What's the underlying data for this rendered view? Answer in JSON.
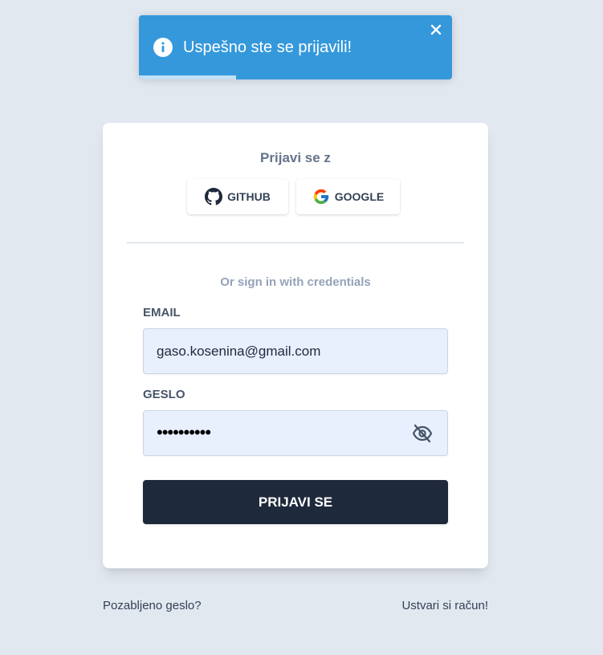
{
  "toast": {
    "message": "Uspešno ste se prijavili!",
    "icon": "info-icon",
    "close_icon": "close-icon",
    "progress": 0.31,
    "color": "#3498db"
  },
  "card": {
    "heading": "Prijavi se z",
    "social": {
      "github_label": "GITHUB",
      "google_label": "GOOGLE"
    },
    "divider_text": "Or sign in with credentials",
    "email": {
      "label": "EMAIL",
      "value": "gaso.kosenina@gmail.com"
    },
    "password": {
      "label": "GESLO",
      "value_masked": "••••••••••",
      "toggle_icon": "eye-slash-icon"
    },
    "submit_label": "PRIJAVI SE"
  },
  "links": {
    "forgot": "Pozabljeno geslo?",
    "create": "Ustvari si račun!"
  },
  "colors": {
    "background": "#e2e8f0",
    "submit": "#1e293b",
    "input_fill": "#e8f0fe"
  }
}
